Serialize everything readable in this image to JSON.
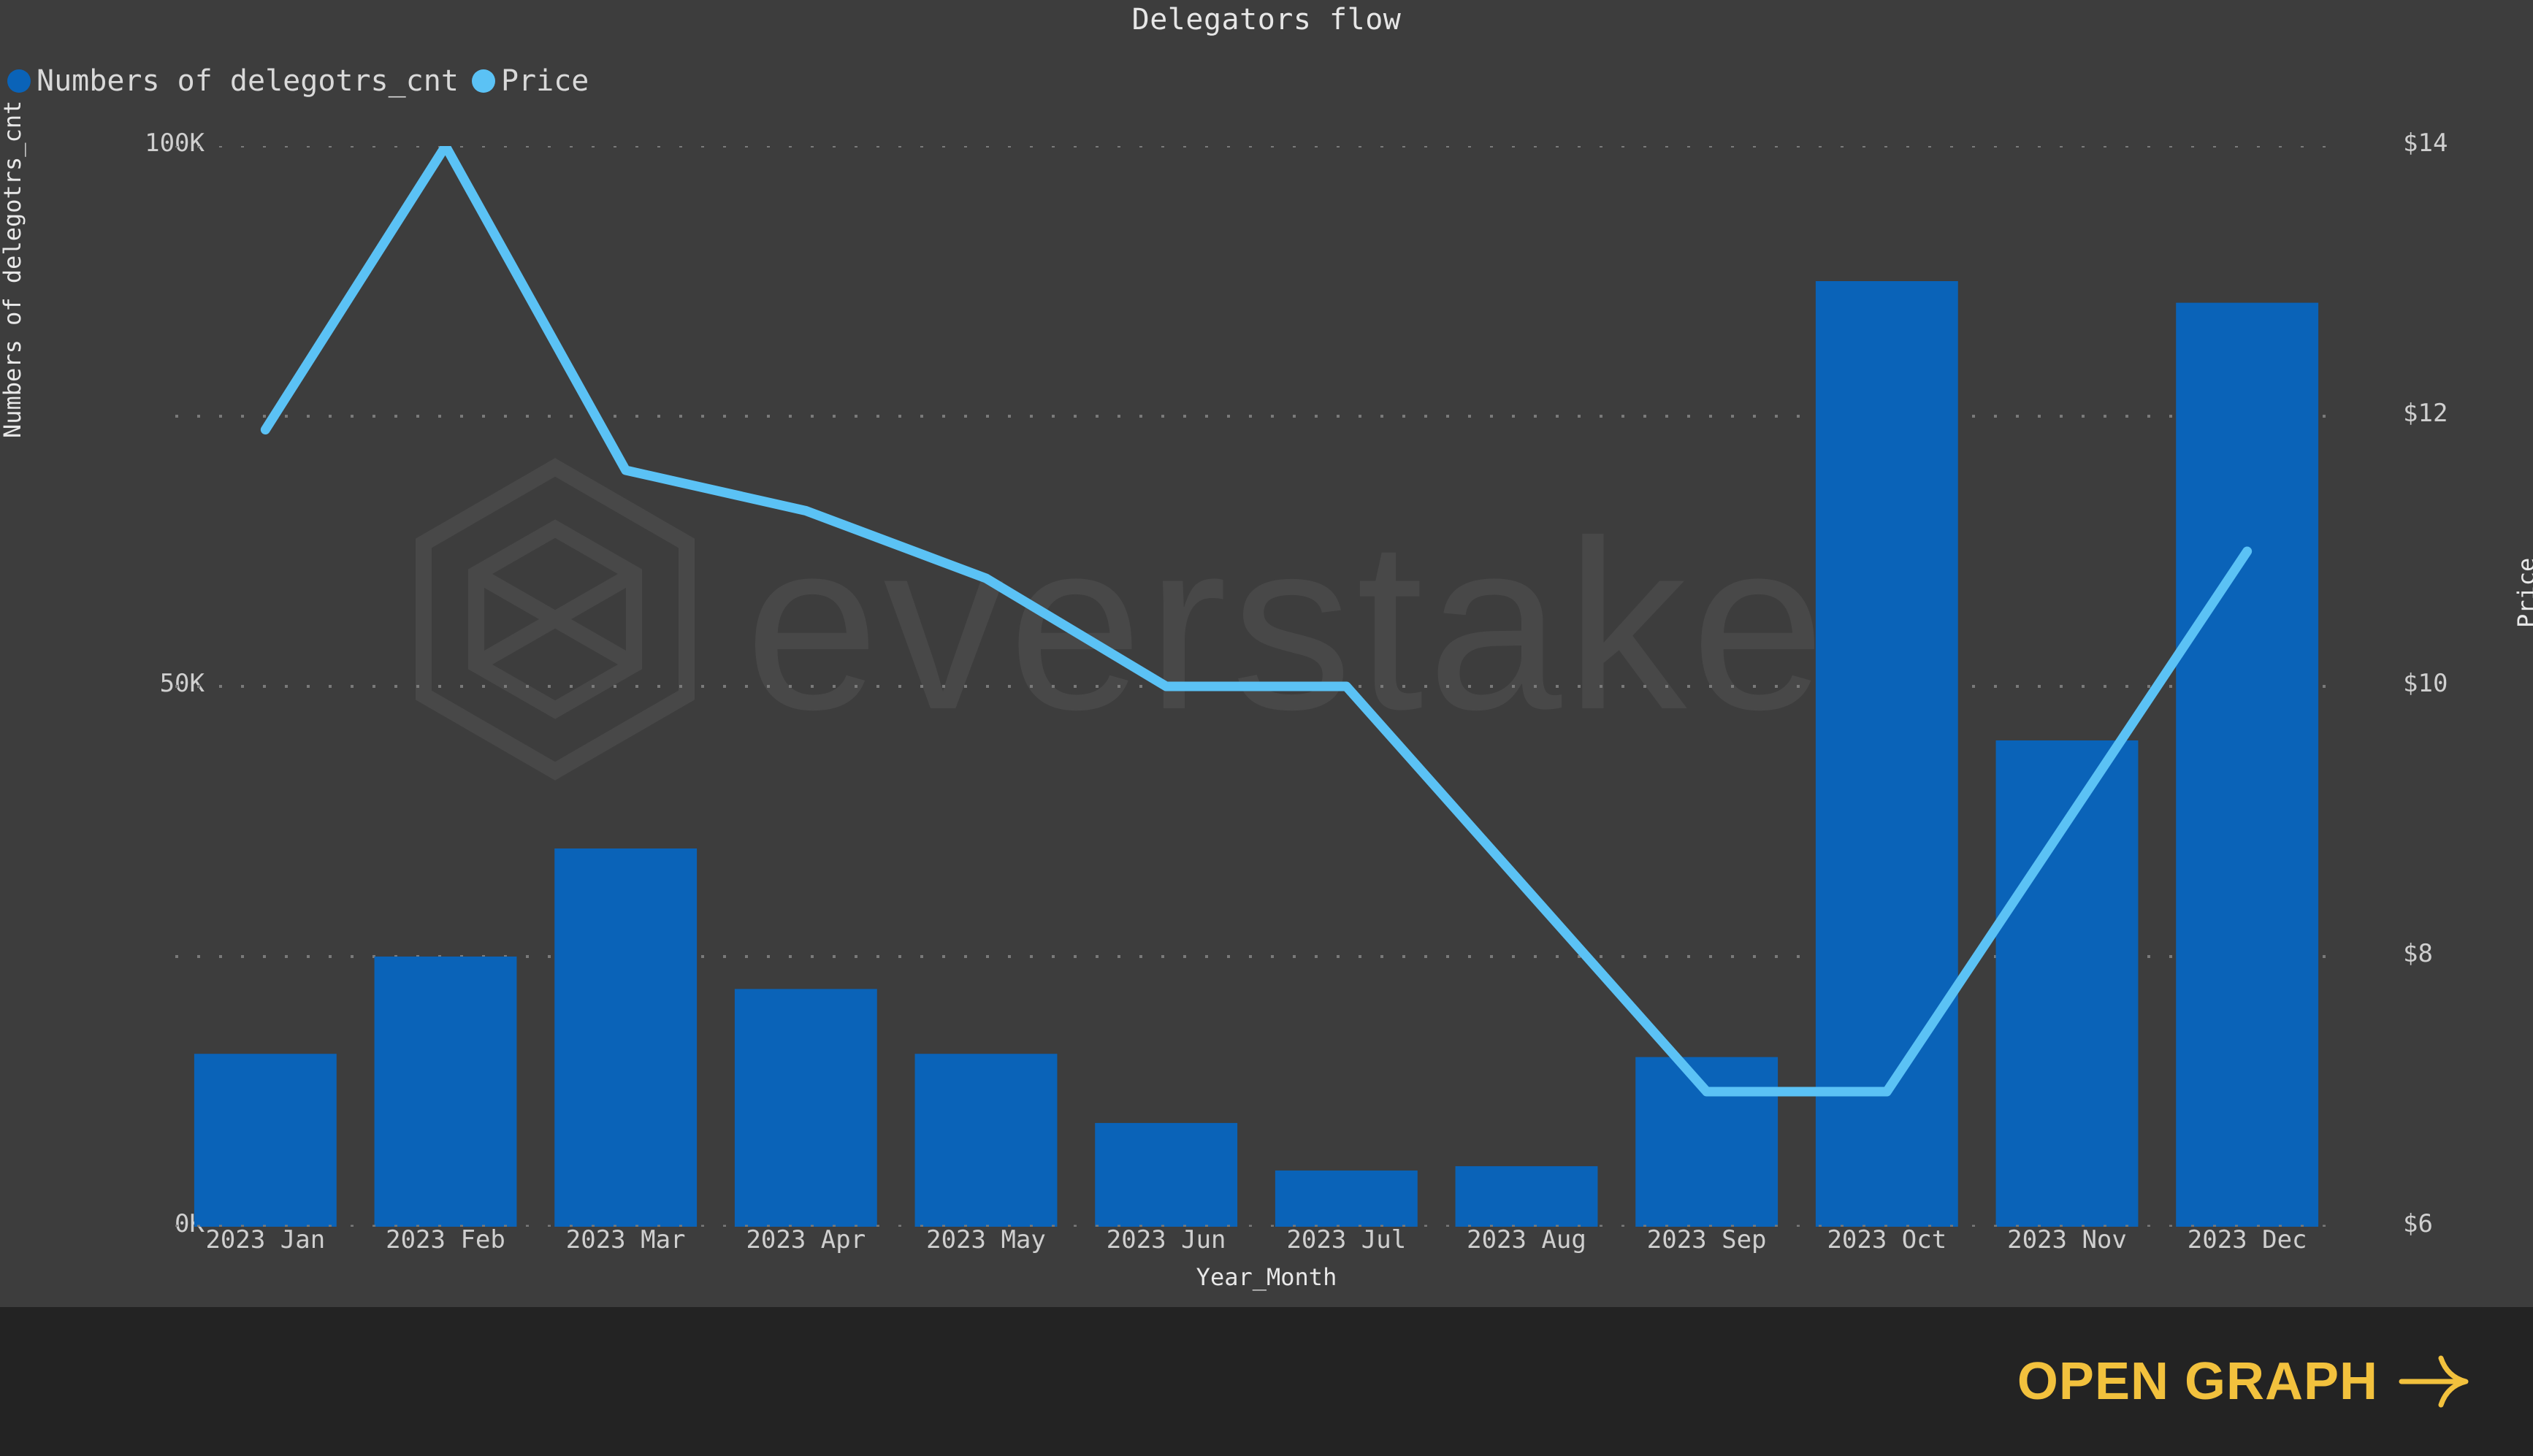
{
  "chart_data": {
    "type": "bar",
    "title": "Delegators flow",
    "xlabel": "Year_Month",
    "ylabel": "Numbers of delegotrs_cnt",
    "y2label": "Price",
    "categories": [
      "2023 Jan",
      "2023 Feb",
      "2023 Mar",
      "2023 Apr",
      "2023 May",
      "2023 Jun",
      "2023 Jul",
      "2023 Aug",
      "2023 Sep",
      "2023 Oct",
      "2023 Nov",
      "2023 Dec"
    ],
    "series": [
      {
        "name": "Numbers of delegotrs_cnt",
        "type": "bar",
        "axis": "left",
        "color": "#0a63b8",
        "values": [
          16000,
          25000,
          35000,
          22000,
          16000,
          9600,
          5200,
          5600,
          15700,
          87500,
          45000,
          85500
        ]
      },
      {
        "name": "Price",
        "type": "line",
        "axis": "right",
        "color": "#5bc2f5",
        "values": [
          11.9,
          14.0,
          11.6,
          11.3,
          10.8,
          10.0,
          10.0,
          8.5,
          7.0,
          7.0,
          9.0,
          11.0
        ]
      }
    ],
    "ylim": [
      0,
      100000
    ],
    "yticks": [
      "0K",
      "50K",
      "100K"
    ],
    "ytick_values": [
      0,
      50000,
      100000
    ],
    "y2lim": [
      6,
      14
    ],
    "y2ticks": [
      "$6",
      "$8",
      "$10",
      "$12",
      "$14"
    ],
    "y2tick_values": [
      6,
      8,
      10,
      12,
      14
    ],
    "grid": true,
    "legend_position": "top-left",
    "watermark": "everstake"
  },
  "legend": {
    "items": [
      {
        "label": "Numbers of delegotrs_cnt",
        "color": "#0a63b8"
      },
      {
        "label": "Price",
        "color": "#5bc2f5"
      }
    ]
  },
  "footer": {
    "open_graph_label": "OPEN GRAPH",
    "arrow_icon": "arrow-right-icon",
    "accent_color": "#f2c13d"
  },
  "theme": {
    "background": "#3d3d3d",
    "footer_background": "#232323",
    "text": "#e6e6e6",
    "grid": "#7a7a7a",
    "bar_color": "#0a63b8",
    "line_color": "#5bc2f5"
  }
}
